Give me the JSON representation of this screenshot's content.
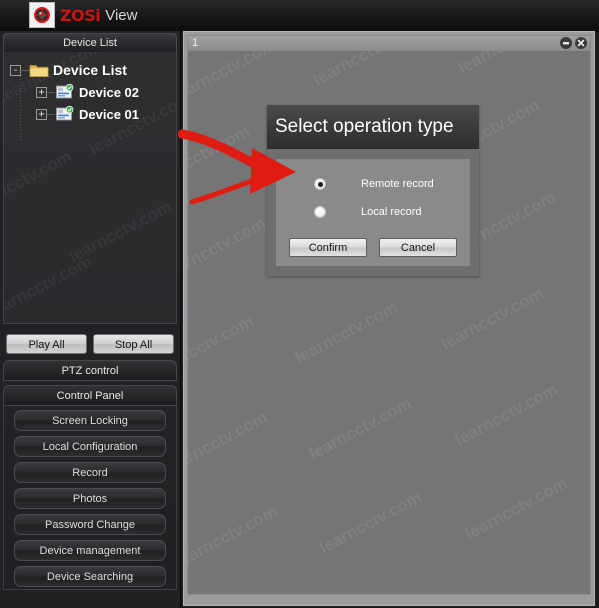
{
  "app": {
    "brand": "ZOSi",
    "brand_suffix": "View",
    "logo_icon": "camera-lens-icon"
  },
  "sidebar": {
    "panel_header": "Device List",
    "tree": {
      "root": {
        "label": "Device List",
        "expander": "-",
        "icon": "folder-icon"
      },
      "children": [
        {
          "label": "Device 02",
          "expander": "+",
          "icon": "device-online-icon"
        },
        {
          "label": "Device 01",
          "expander": "+",
          "icon": "device-online-icon"
        }
      ]
    },
    "quick_buttons": [
      {
        "label": "Play All"
      },
      {
        "label": "Stop All"
      }
    ],
    "ptz_header": "PTZ control",
    "control_panel_header": "Control Panel",
    "control_buttons": [
      {
        "label": "Screen Locking"
      },
      {
        "label": "Local Configuration"
      },
      {
        "label": "Record"
      },
      {
        "label": "Photos"
      },
      {
        "label": "Password Change"
      },
      {
        "label": "Device management"
      },
      {
        "label": "Device Searching"
      }
    ]
  },
  "video": {
    "channel_index": "1",
    "minimize_icon": "minimize-icon",
    "close_icon": "close-icon",
    "watermark_text": "learncctv.com"
  },
  "dialog": {
    "title": "Select operation type",
    "options": [
      {
        "label": "Remote record",
        "selected": true
      },
      {
        "label": "Local record",
        "selected": false
      }
    ],
    "confirm_label": "Confirm",
    "cancel_label": "Cancel"
  },
  "annotation": {
    "arrow_color": "#e01b12",
    "arrow_target": "remote-record-radio"
  },
  "colors": {
    "brand_red": "#c81414",
    "panel_dark": "#242427",
    "video_gray": "#757575",
    "dialog_gray": "#6e6e6e",
    "dialog_inner_gray": "#8a8a8a"
  }
}
